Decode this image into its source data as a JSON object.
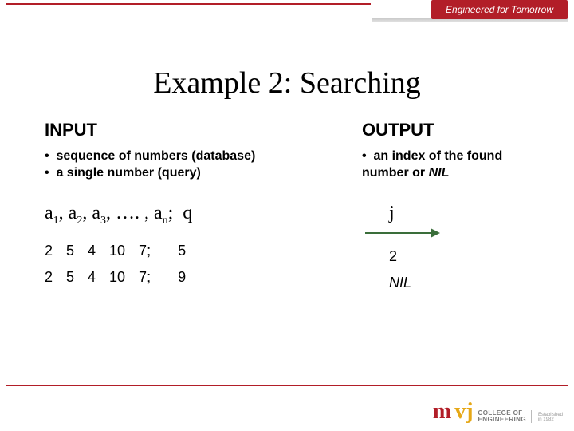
{
  "brand": {
    "tagline": "Engineered for Tomorrow",
    "logo_line1": "COLLEGE OF",
    "logo_line2": "ENGINEERING",
    "logo_m": "m",
    "logo_v": "vj",
    "est1": "Established",
    "est2": "in 1982"
  },
  "title": "Example 2: Searching",
  "input": {
    "heading": "INPUT",
    "desc1": "sequence of numbers (database)",
    "desc2": "a single number (query)",
    "formula": {
      "a": "a",
      "sub1": "1",
      "sub2": "2",
      "sub3": "3",
      "dots": ", …. , ",
      "subn": "n",
      "sep": ";",
      "q": "q"
    },
    "examples": [
      {
        "seq": "2   5   4   10   7;",
        "q": "5"
      },
      {
        "seq": "2   5   4   10   7;",
        "q": "9"
      }
    ]
  },
  "output": {
    "heading": "OUTPUT",
    "desc1_a": "an index of the found",
    "desc1_b": "number or ",
    "desc1_nil": "NIL",
    "j": "j",
    "results": [
      {
        "value": "2",
        "nil": false
      },
      {
        "value": "NIL",
        "nil": true
      }
    ]
  }
}
